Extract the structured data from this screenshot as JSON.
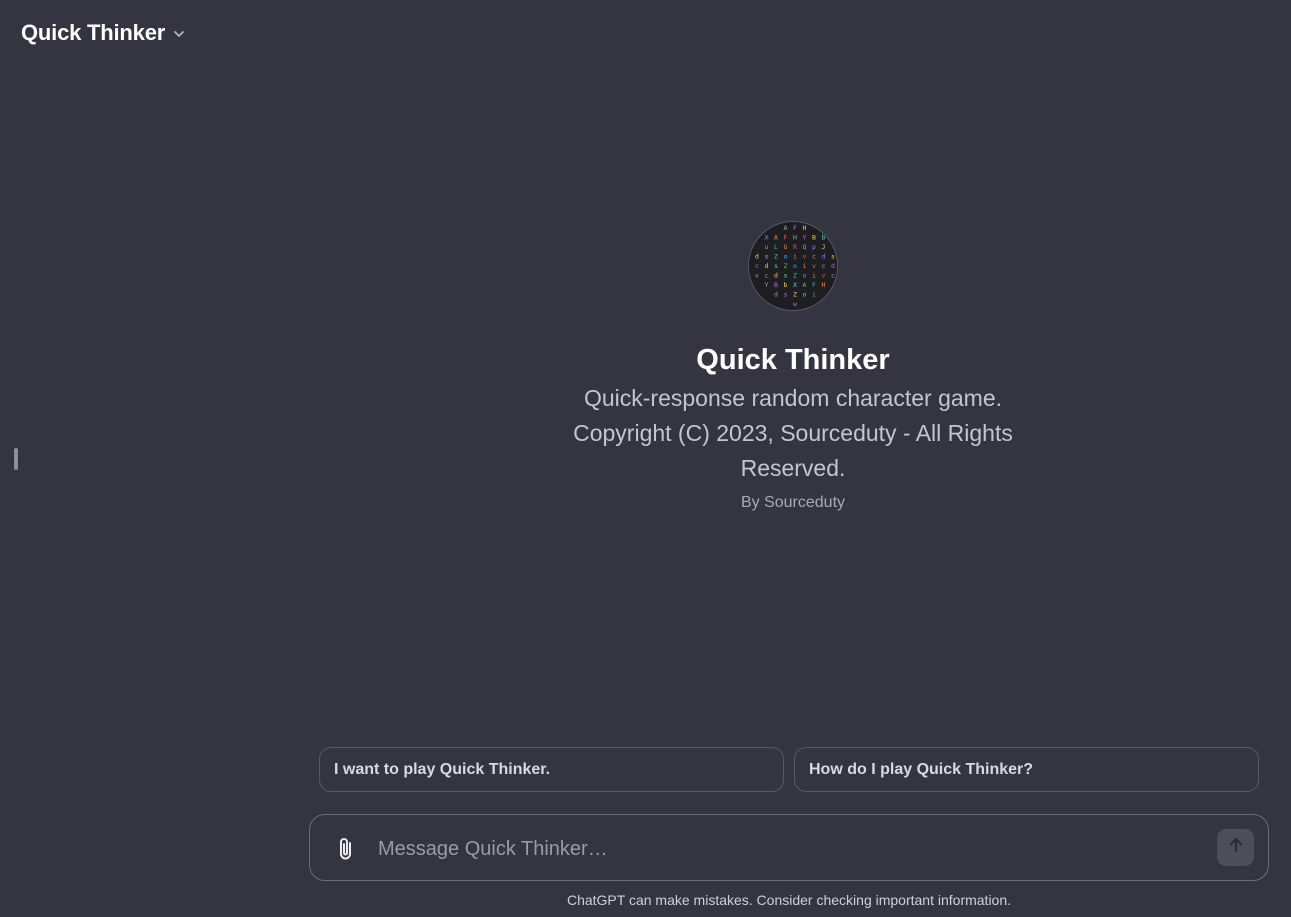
{
  "header": {
    "model_name": "Quick Thinker",
    "dropdown_icon": "chevron-down-icon"
  },
  "gpt": {
    "name": "Quick Thinker",
    "description": "Quick-response random character game. Copyright (C) 2023, Sourceduty - All Rights Reserved.",
    "author": "By Sourceduty",
    "avatar_icon": "random-characters-logo"
  },
  "suggestions": [
    {
      "label": "I want to play Quick Thinker."
    },
    {
      "label": "How do I play Quick Thinker?"
    }
  ],
  "composer": {
    "placeholder": "Message Quick Thinker…",
    "attach_icon": "paperclip-icon",
    "send_icon": "arrow-up-icon"
  },
  "footer": {
    "disclaimer": "ChatGPT can make mistakes. Consider checking important information."
  },
  "colors": {
    "background": "#343541",
    "border": "#565869",
    "text_primary": "#ffffff",
    "text_secondary": "#c5c5d2"
  }
}
